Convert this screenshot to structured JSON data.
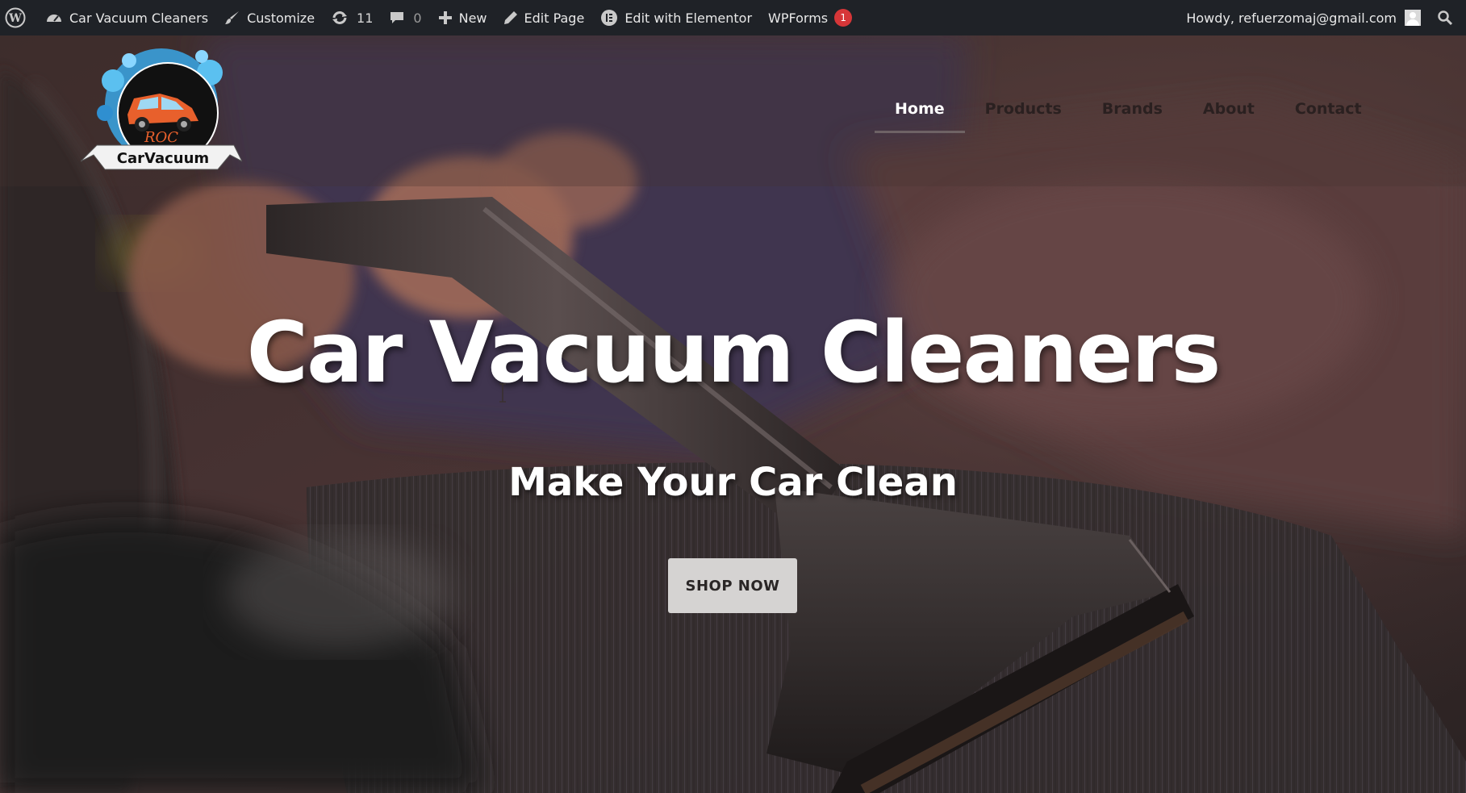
{
  "admin_bar": {
    "site_name": "Car Vacuum Cleaners",
    "customize": "Customize",
    "updates_count": "11",
    "comments_count": "0",
    "new": "New",
    "edit_page": "Edit Page",
    "edit_with_elementor": "Edit with Elementor",
    "wpforms": "WPForms",
    "wpforms_badge": "1",
    "howdy": "Howdy, refuerzomaj@gmail.com",
    "icons": {
      "wp": "wordpress-logo-icon",
      "site": "dashboard-icon",
      "customize": "brush-icon",
      "updates": "refresh-icon",
      "comments": "comment-bubble-icon",
      "new": "plus-icon",
      "edit": "pencil-icon",
      "elementor": "elementor-icon",
      "avatar": "user-avatar-icon",
      "search": "search-icon"
    }
  },
  "site_header": {
    "logo": {
      "text_top": "ROC",
      "text_banner": "CarVacuum"
    },
    "nav": [
      {
        "label": "Home",
        "active": true
      },
      {
        "label": "Products",
        "active": false
      },
      {
        "label": "Brands",
        "active": false
      },
      {
        "label": "About",
        "active": false
      },
      {
        "label": "Contact",
        "active": false
      }
    ]
  },
  "hero": {
    "title": "Car Vacuum Cleaners",
    "subtitle": "Make Your Car Clean",
    "cta_label": "SHOP NOW"
  },
  "colors": {
    "admin_bar_bg": "#1f2227",
    "badge_red": "#d63638",
    "button_bg": "#d5d3d2",
    "nav_active": "#ffffff",
    "nav_inactive": "#2a2020",
    "logo_blue": "#3aa7e6",
    "logo_car": "#e8602c"
  }
}
